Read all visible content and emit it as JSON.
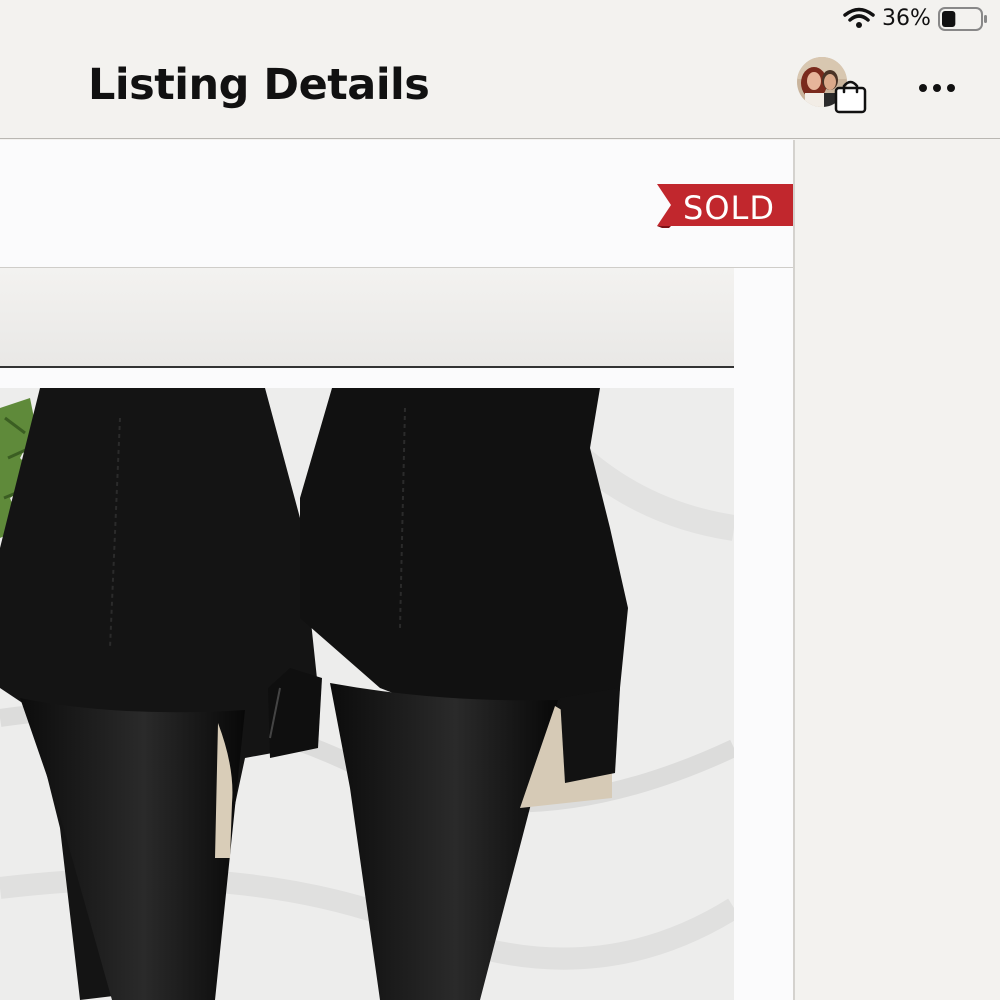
{
  "status_bar": {
    "wifi_icon": "wifi-icon",
    "battery_percent": "36%",
    "battery_icon": "battery-icon",
    "battery_level": 0.36
  },
  "nav": {
    "title": "Listing Details",
    "avatar_icon": "avatar-with-shopping-bag",
    "bag_icon": "shopping-bag-icon",
    "more_icon": "more-horizontal-icon"
  },
  "listing": {
    "status_badge": "SOLD",
    "badge_color": "#c1272d",
    "image_icon": "product-photo-black-suede-heeled-booties"
  }
}
